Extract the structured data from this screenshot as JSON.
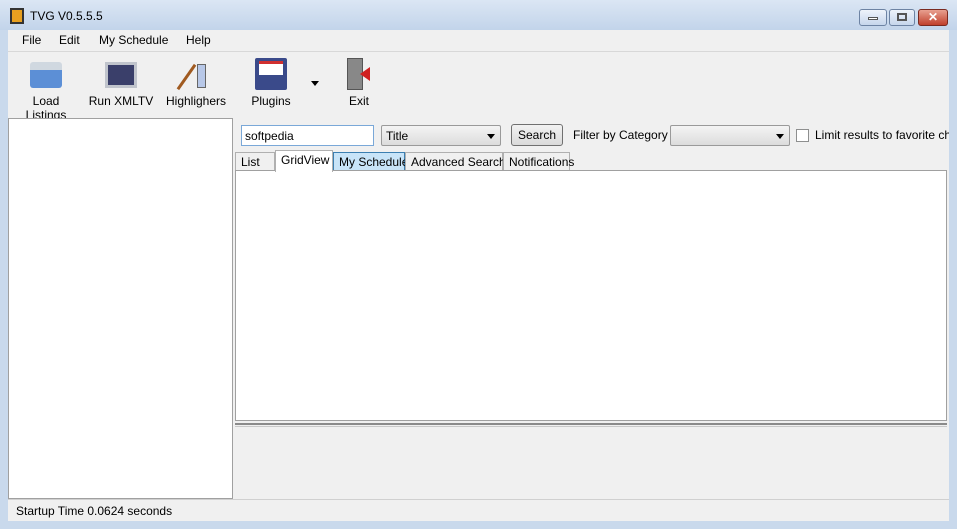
{
  "window": {
    "title": "TVG V0.5.5.5",
    "close_glyph": "✕"
  },
  "menu": [
    "File",
    "Edit",
    "My Schedule",
    "Help"
  ],
  "toolbar": {
    "load": "Load Listings",
    "run": "Run XMLTV",
    "high": "Highlighers",
    "plugins": "Plugins",
    "exit": "Exit"
  },
  "search": {
    "value": "softpedia",
    "field": "Title",
    "button": "Search",
    "filter_label": "Filter by Category",
    "category": "",
    "limit_label": "Limit results to favorite chann",
    "limit_checked": false
  },
  "tabs": [
    "List",
    "GridView",
    "My Schedule",
    "Advanced Search",
    "Notifications"
  ],
  "status": "Startup Time 0.0624 seconds"
}
